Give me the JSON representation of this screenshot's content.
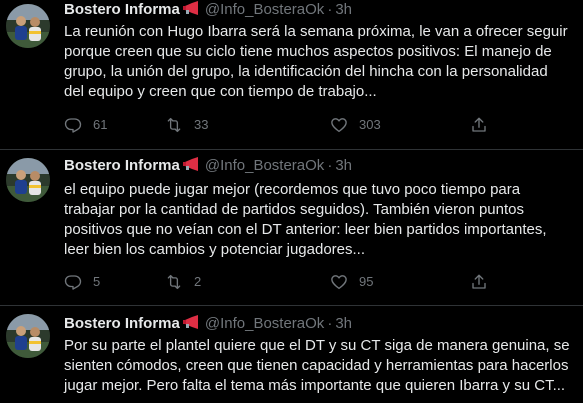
{
  "colors": {
    "background": "#000000",
    "text_primary": "#e7e9ea",
    "text_secondary": "#71767b",
    "divider": "#2f3336",
    "megaphone_accent": "#dd2e44"
  },
  "tweets": [
    {
      "author": "Bostero Informa",
      "badge_icon": "megaphone-icon",
      "handle": "@Info_BosteraOk",
      "separator": "·",
      "time": "3h",
      "lines": [
        "La reunión con Hugo Ibarra será la semana próxima, le van a ofrecer seguir",
        "porque creen que su ciclo tiene muchos aspectos positivos: El manejo de",
        "grupo, la unión del grupo, la identificación del hincha con la personalidad",
        "del equipo y creen que con tiempo de trabajo..."
      ],
      "replies": "61",
      "retweets": "33",
      "likes": "303"
    },
    {
      "author": "Bostero Informa",
      "badge_icon": "megaphone-icon",
      "handle": "@Info_BosteraOk",
      "separator": "·",
      "time": "3h",
      "lines": [
        "el equipo puede jugar mejor (recordemos que tuvo poco tiempo para",
        "trabajar por la cantidad de partidos seguidos). También vieron puntos",
        "positivos que no veían con el DT anterior: leer bien partidos importantes,",
        "leer bien los cambios y potenciar jugadores..."
      ],
      "replies": "5",
      "retweets": "2",
      "likes": "95"
    },
    {
      "author": "Bostero Informa",
      "badge_icon": "megaphone-icon",
      "handle": "@Info_BosteraOk",
      "separator": "·",
      "time": "3h",
      "lines": [
        "Por su parte el plantel quiere que el DT y su CT siga de manera genuina, se",
        "sienten cómodos, creen que tienen capacidad y herramientas para hacerlos",
        "jugar mejor. Pero falta el tema más importante que quieren Ibarra y su CT..."
      ]
    }
  ]
}
